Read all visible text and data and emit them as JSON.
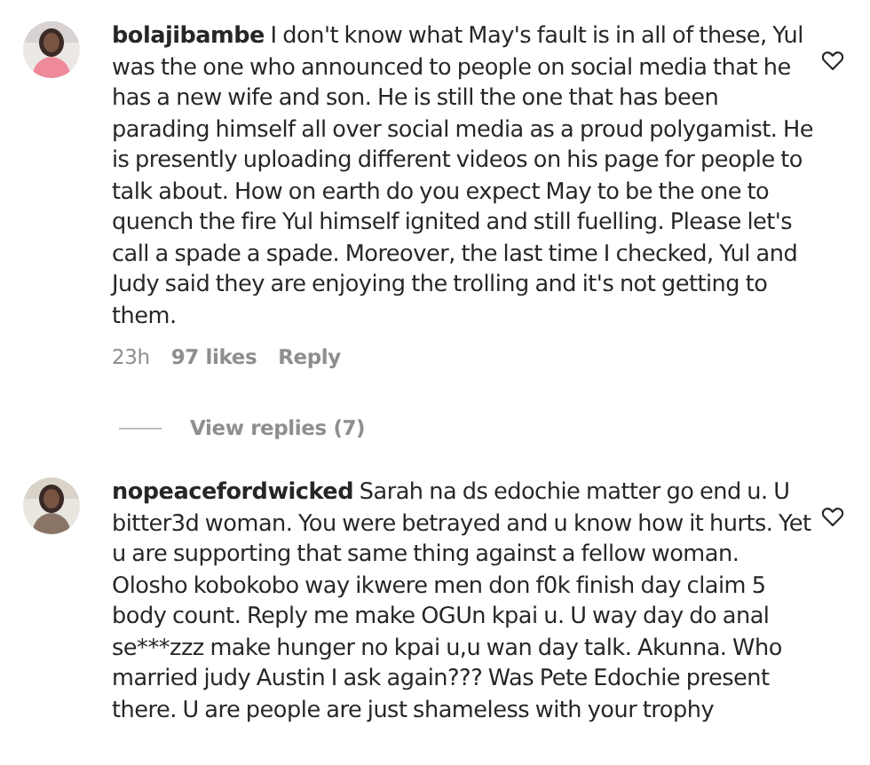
{
  "comments": [
    {
      "username": "bolajibambe",
      "text": "I don't know what May's fault is in all of these, Yul was the one who announced to people on social media that he has a new wife and son. He is still the one that has been parading himself all over social media as a proud polygamist. He is presently uploading different videos on his page for people to talk about. How on earth do you expect May to be the one to quench the fire Yul himself ignited and still fuelling. Please let's call a spade a spade. Moreover, the last time I checked, Yul and Judy said they are enjoying the trolling and it's not getting to them.",
      "time": "23h",
      "likes": "97 likes",
      "reply": "Reply",
      "view_replies": "View replies (7)"
    },
    {
      "username": "nopeacefordwicked",
      "text": "Sarah na ds edochie matter go end u. U bitter3d woman. You were betrayed and u know how it hurts. Yet u are supporting that same thing against a fellow woman. Olosho kobokobo way ikwere men don f0k finish day claim 5 body count. Reply me make OGUn kpai u. U way day do anal se***zzz make hunger no kpai u,u wan day talk. Akunna. Who married judy Austin I ask again??? Was Pete Edochie present there. U are people are just shameless with your trophy"
    }
  ]
}
